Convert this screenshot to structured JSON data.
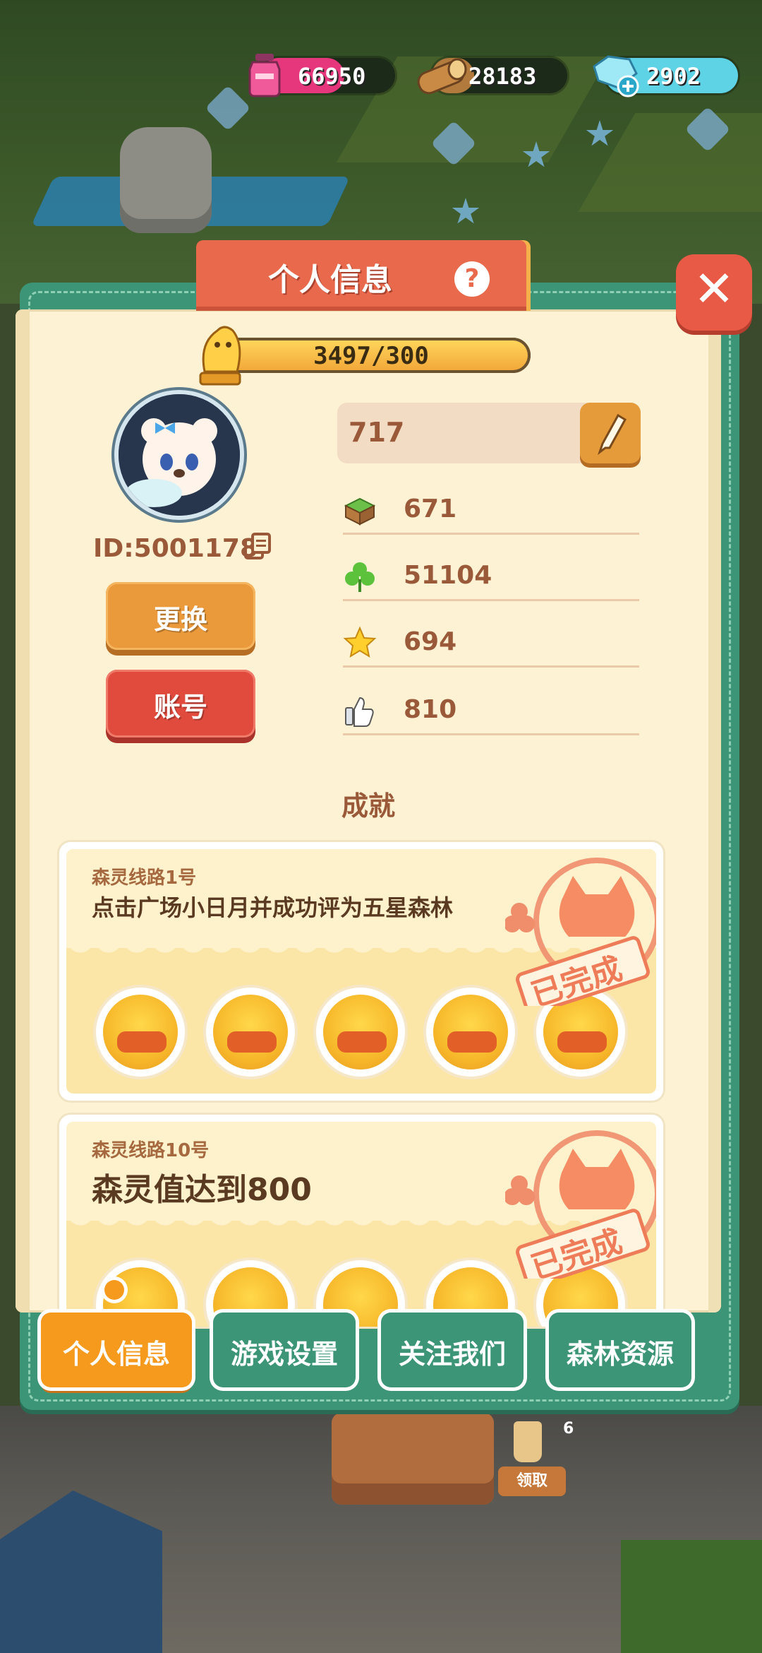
{
  "currencies": {
    "potion": {
      "value": "66950",
      "color": "#e6367c"
    },
    "wood": {
      "value": "28183",
      "color": "#b37a3d"
    },
    "gem": {
      "value": "2902",
      "color": "#5fd3e6"
    }
  },
  "panel": {
    "title": "个人信息",
    "help_symbol": "?",
    "close_symbol": "✕"
  },
  "profile": {
    "xp_text": "3497/300",
    "xp_fraction": 1.0,
    "id_text": "ID:5001178",
    "change_button": "更换",
    "account_button": "账号",
    "name": "717"
  },
  "stats": [
    {
      "icon": "grass-block-icon",
      "value": "671"
    },
    {
      "icon": "clover-icon",
      "value": "51104"
    },
    {
      "icon": "star-icon",
      "value": "694"
    },
    {
      "icon": "thumbs-up-icon",
      "value": "810"
    }
  ],
  "achievements": {
    "title": "成就",
    "items": [
      {
        "label": "森灵线路1号",
        "desc": "点击广场小日月并成功评为五星森林",
        "stamp": "已完成"
      },
      {
        "label": "森灵线路10号",
        "desc": "森灵值达到800",
        "stamp": "已完成"
      }
    ]
  },
  "tabs": [
    {
      "label": "个人信息",
      "active": true
    },
    {
      "label": "游戏设置",
      "active": false
    },
    {
      "label": "关注我们",
      "active": false
    },
    {
      "label": "森林资源",
      "active": false
    }
  ],
  "background": {
    "cup_count": "6",
    "claim_label": "领取"
  }
}
